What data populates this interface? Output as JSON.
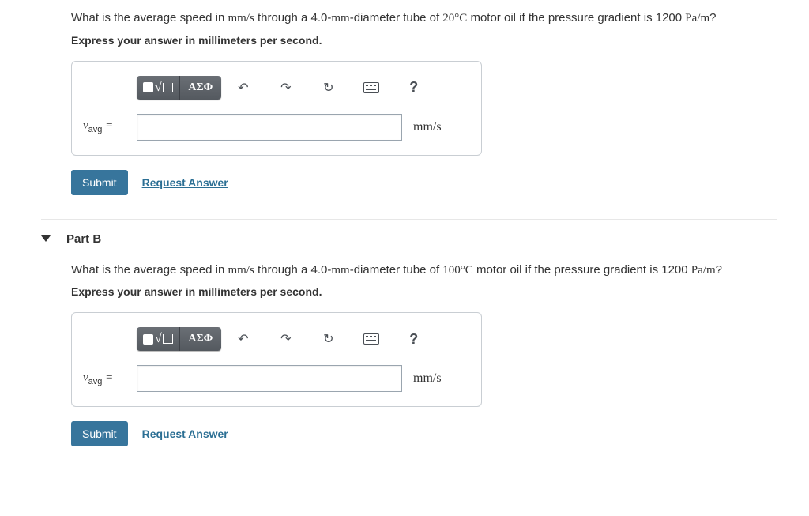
{
  "partA": {
    "question_pre": "What is the average speed in ",
    "question_unit1": "mm/s",
    "question_mid1": " through a 4.0-",
    "question_mm": "mm",
    "question_mid2": "-diameter tube of ",
    "question_temp": "20°C",
    "question_mid3": " motor oil if the pressure gradient is 1200 ",
    "question_unit2": "Pa/m",
    "question_end": "?",
    "instruct": "Express your answer in millimeters per second.",
    "var_name": "v",
    "var_sub": "avg",
    "var_eq": " =",
    "unit": "mm/s",
    "submit": "Submit",
    "request": "Request Answer"
  },
  "partB": {
    "title": "Part B",
    "question_pre": "What is the average speed in ",
    "question_unit1": "mm/s",
    "question_mid1": " through a 4.0-",
    "question_mm": "mm",
    "question_mid2": "-diameter tube of ",
    "question_temp": "100°C",
    "question_mid3": " motor oil if the pressure gradient is 1200 ",
    "question_unit2": "Pa/m",
    "question_end": "?",
    "instruct": "Express your answer in millimeters per second.",
    "var_name": "v",
    "var_sub": "avg",
    "var_eq": " =",
    "unit": "mm/s",
    "submit": "Submit",
    "request": "Request Answer"
  },
  "toolbar": {
    "greek": "ΑΣΦ",
    "help": "?"
  }
}
